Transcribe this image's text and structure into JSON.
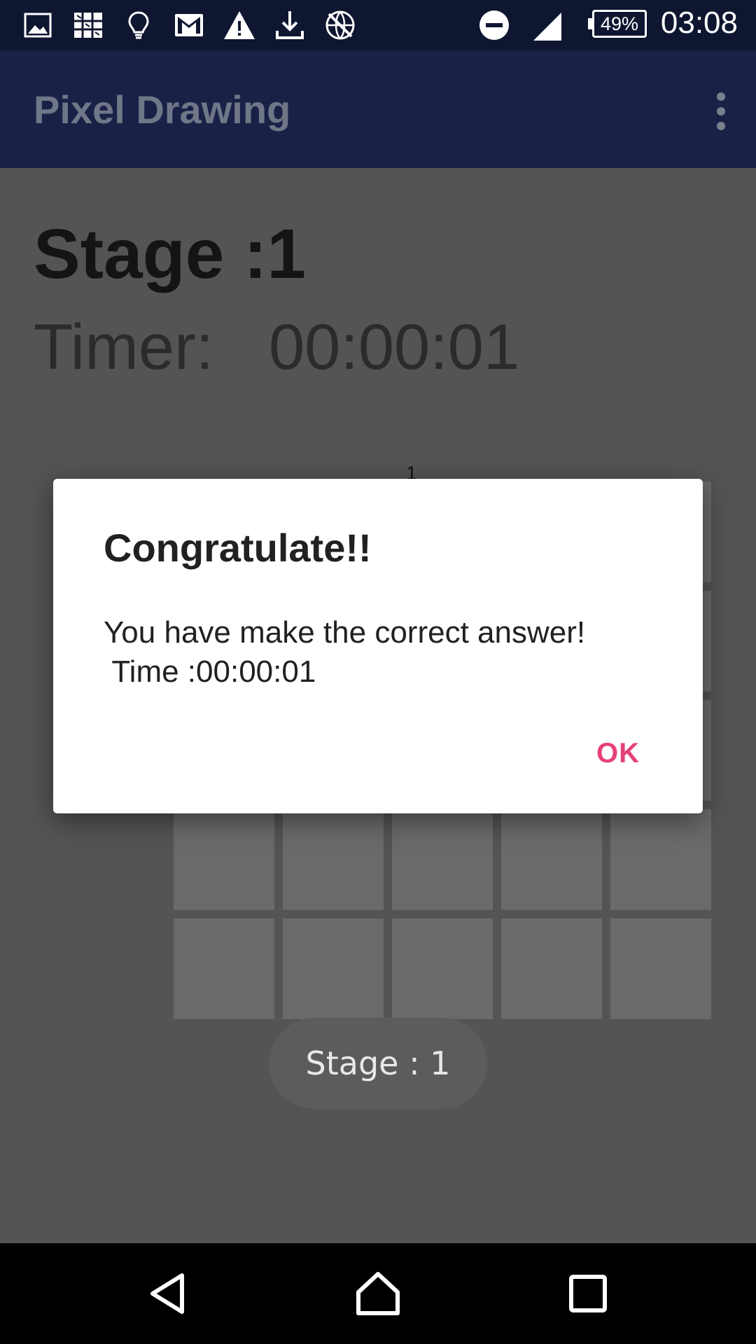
{
  "status_bar": {
    "icons": [
      "image-icon",
      "grid-app-icon",
      "lightbulb-icon",
      "gmail-icon",
      "warning-icon",
      "download-icon",
      "blocked-globe-icon"
    ],
    "dnd_icon": "do-not-disturb-icon",
    "signal_icon": "signal-icon",
    "battery_percent": "49%",
    "time": "03:08"
  },
  "app_bar": {
    "title": "Pixel Drawing",
    "menu_icon": "overflow-menu-icon"
  },
  "content": {
    "stage_heading": "Stage :1",
    "timer_label": "Timer:",
    "timer_value": "00:00:01",
    "column_number": "1",
    "grid_rows": 5,
    "grid_cols": 5
  },
  "dialog": {
    "title": "Congratulate!!",
    "message_line1": "You have make the correct answer!",
    "message_line2": " Time :00:00:01",
    "ok_label": "OK"
  },
  "toast": {
    "text": "Stage : 1"
  },
  "nav_bar": {
    "back_icon": "back-icon",
    "home_icon": "home-icon",
    "recents_icon": "recents-icon"
  },
  "colors": {
    "status_bar": "#0f1630",
    "app_bar": "#1a2147",
    "accent": "#e6407a",
    "scrim_background": "#545454"
  }
}
